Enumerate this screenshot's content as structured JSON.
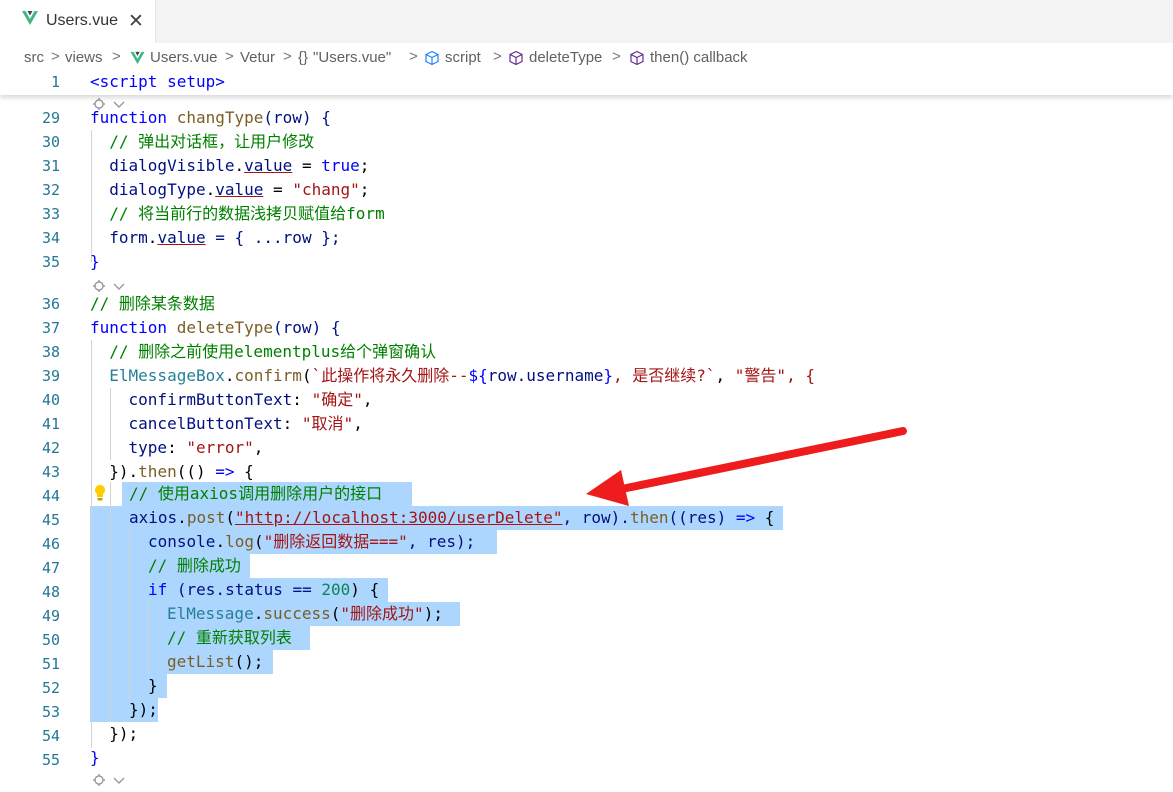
{
  "tab": {
    "file_name": "Users.vue",
    "close": "✕"
  },
  "breadcrumb": {
    "src": "src",
    "views": "views",
    "file": "Users.vue",
    "vetur": "Vetur",
    "module": "\"Users.vue\"",
    "script": "script",
    "deleteType": "deleteType",
    "callback": "then() callback",
    "sep": ">",
    "braces": "{}"
  },
  "colors": {
    "selection": "#add6ff",
    "keyword": "#0000ff",
    "comment": "#008000",
    "string": "#a31515",
    "arrow": "#ee1c1c"
  },
  "code": {
    "l1": {
      "num": "1",
      "text": "<script setup>"
    },
    "l29": {
      "num": "29",
      "kw": "function",
      "fn": "changType",
      "rest": "(row) {"
    },
    "l30": {
      "num": "30",
      "text": "  // 弹出对话框，让用户修改"
    },
    "l31": {
      "num": "31",
      "var": "dialogVisible",
      "prop": "value",
      "rest": " = ",
      "val": "true",
      "end": ";"
    },
    "l32": {
      "num": "32",
      "var": "dialogType",
      "prop": "value",
      "rest": " = ",
      "str": "\"chang\"",
      "end": ";"
    },
    "l33": {
      "num": "33",
      "text": "  // 将当前行的数据浅拷贝赋值给form"
    },
    "l34": {
      "num": "34",
      "var": "form",
      "prop": "value",
      "rest": " = { ...row };"
    },
    "l35": {
      "num": "35",
      "text": "}"
    },
    "l36": {
      "num": "36",
      "text": "// 删除某条数据"
    },
    "l37": {
      "num": "37",
      "kw": "function",
      "fn": "deleteType",
      "rest": "(row) {"
    },
    "l38": {
      "num": "38",
      "text": "  // 删除之前使用elementplus给个弹窗确认"
    },
    "l39": {
      "num": "39",
      "obj": "ElMessageBox",
      "fn": "confirm",
      "s1": "`此操作将永久删除--",
      "tpl_open": "${",
      "tpl_var": "row.username",
      "tpl_close": "}",
      "s2": ", 是否继续?`",
      "comma": ", ",
      "s3": "\"警告\"",
      "end": ", {"
    },
    "l40": {
      "num": "40",
      "key": "confirmButtonText",
      "str": "\"确定\"",
      "end": ","
    },
    "l41": {
      "num": "41",
      "key": "cancelButtonText",
      "str": "\"取消\"",
      "end": ","
    },
    "l42": {
      "num": "42",
      "key": "type",
      "str": "\"error\"",
      "end": ","
    },
    "l43": {
      "num": "43",
      "pre": "  }).",
      "fn": "then",
      "rest": "(() ",
      "arrow": "=>",
      "end": " {"
    },
    "l44": {
      "num": "44",
      "text": "// 使用axios调用删除用户的接口"
    },
    "l45": {
      "num": "45",
      "obj": "axios",
      "fn": "post",
      "url": "\"http://localhost:3000/userDelete\"",
      "mid": ", row).",
      "fn2": "then",
      "rest": "((res) ",
      "arrow": "=>",
      "end": " {"
    },
    "l46": {
      "num": "46",
      "obj": "console",
      "fn": "log",
      "str": "\"删除返回数据===\"",
      "end": ", res);"
    },
    "l47": {
      "num": "47",
      "text": "// 删除成功"
    },
    "l48": {
      "num": "48",
      "kw": "if",
      "rest": " (res.status == ",
      "numv": "200",
      "end": ") {"
    },
    "l49": {
      "num": "49",
      "obj": "ElMessage",
      "fn": "success",
      "str": "\"删除成功\"",
      "end": ");"
    },
    "l50": {
      "num": "50",
      "text": "// 重新获取列表"
    },
    "l51": {
      "num": "51",
      "fn": "getList",
      "end": "();"
    },
    "l52": {
      "num": "52",
      "text": "}"
    },
    "l53": {
      "num": "53",
      "text": "});"
    },
    "l54": {
      "num": "54",
      "text": "  });"
    },
    "l55": {
      "num": "55",
      "text": "}"
    }
  }
}
